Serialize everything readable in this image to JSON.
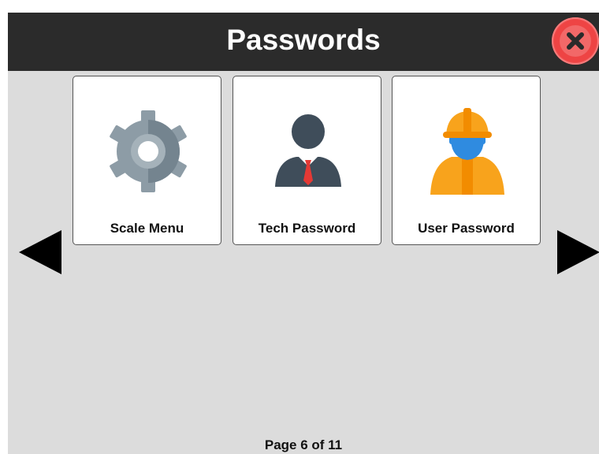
{
  "header": {
    "title": "Passwords",
    "close_icon": "close-icon",
    "close_color": "#f14e4e"
  },
  "tiles": [
    {
      "label": "Scale Menu",
      "icon": "gear-icon"
    },
    {
      "label": "Tech Password",
      "icon": "technician-icon"
    },
    {
      "label": "User Password",
      "icon": "worker-hardhat-icon"
    }
  ],
  "navigation": {
    "prev_icon": "triangle-left-icon",
    "next_icon": "triangle-right-icon"
  },
  "pagination": {
    "text": "Page 6 of 11",
    "current": 6,
    "total": 11
  },
  "colors": {
    "titlebar": "#2b2b2b",
    "background": "#dcdcdc",
    "accent_orange": "#f8a31c",
    "gear_gray": "#8d9ca6"
  }
}
